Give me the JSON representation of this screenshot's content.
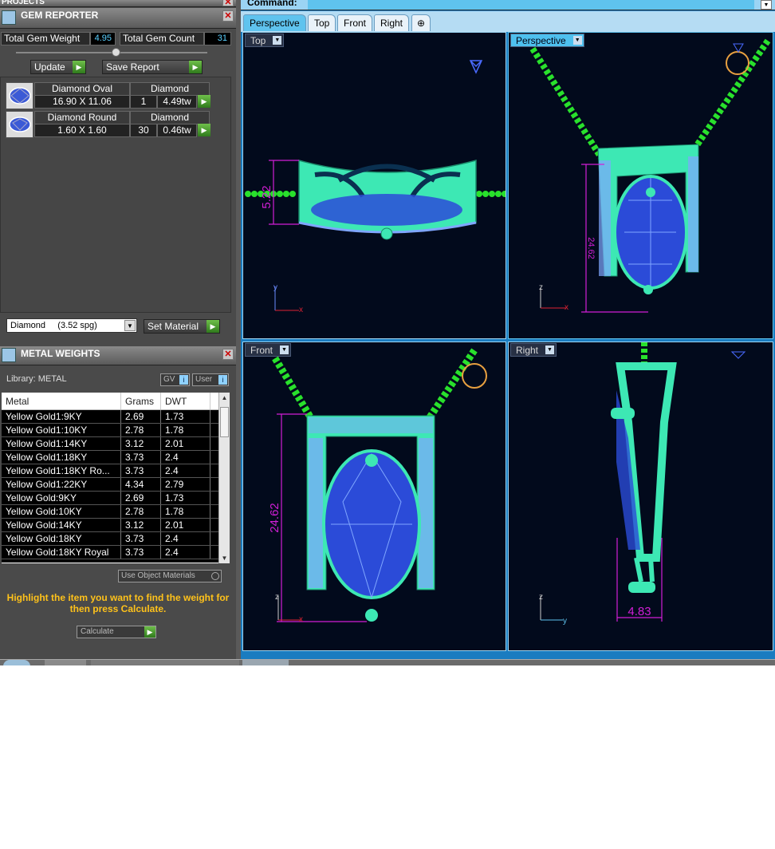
{
  "projects_title": "PROJECTS",
  "gem_reporter": {
    "title": "GEM REPORTER",
    "total_weight_label": "Total Gem Weight",
    "total_weight_value": "4.95",
    "total_count_label": "Total Gem Count",
    "total_count_value": "31",
    "update_label": "Update",
    "save_report_label": "Save Report",
    "gems": [
      {
        "name": "Diamond Oval",
        "material": "Diamond",
        "size": "16.90 X 11.06",
        "count": "1",
        "weight": "4.49tw"
      },
      {
        "name": "Diamond Round",
        "material": "Diamond",
        "size": "1.60 X 1.60",
        "count": "30",
        "weight": "0.46tw"
      }
    ],
    "material_select": "Diamond     (3.52 spg)",
    "set_material_label": "Set Material"
  },
  "metal_weights": {
    "title": "METAL WEIGHTS",
    "library_label": "Library: METAL",
    "gv_label": "GV",
    "user_label": "User",
    "headers": [
      "Metal",
      "Grams",
      "DWT"
    ],
    "rows": [
      [
        "Yellow Gold1:9KY",
        "2.69",
        "1.73"
      ],
      [
        "Yellow Gold1:10KY",
        "2.78",
        "1.78"
      ],
      [
        "Yellow Gold1:14KY",
        "3.12",
        "2.01"
      ],
      [
        "Yellow Gold1:18KY",
        "3.73",
        "2.4"
      ],
      [
        "Yellow Gold1:18KY Ro...",
        "3.73",
        "2.4"
      ],
      [
        "Yellow Gold1:22KY",
        "4.34",
        "2.79"
      ],
      [
        "Yellow Gold:9KY",
        "2.69",
        "1.73"
      ],
      [
        "Yellow Gold:10KY",
        "2.78",
        "1.78"
      ],
      [
        "Yellow Gold:14KY",
        "3.12",
        "2.01"
      ],
      [
        "Yellow Gold:18KY",
        "3.73",
        "2.4"
      ],
      [
        "Yellow Gold:18KY Royal",
        "3.73",
        "2.4"
      ]
    ],
    "use_object_materials": "Use Object Materials",
    "hint": "Highlight the item you want to find the weight for then press Calculate.",
    "calculate_label": "Calculate"
  },
  "command_label": "Command:",
  "view_tabs": [
    "Perspective",
    "Top",
    "Front",
    "Right"
  ],
  "viewports": {
    "top": {
      "label": "Top",
      "dimension": "5.22"
    },
    "perspective": {
      "label": "Perspective",
      "dimension": "24.62"
    },
    "front": {
      "label": "Front",
      "dimension": "24.62"
    },
    "right": {
      "label": "Right",
      "dimension": "4.83"
    }
  },
  "colors": {
    "metal": "#3de8b4",
    "chain": "#29e12c",
    "gem": "#2b4bd8",
    "dimension": "#d21fd6"
  }
}
